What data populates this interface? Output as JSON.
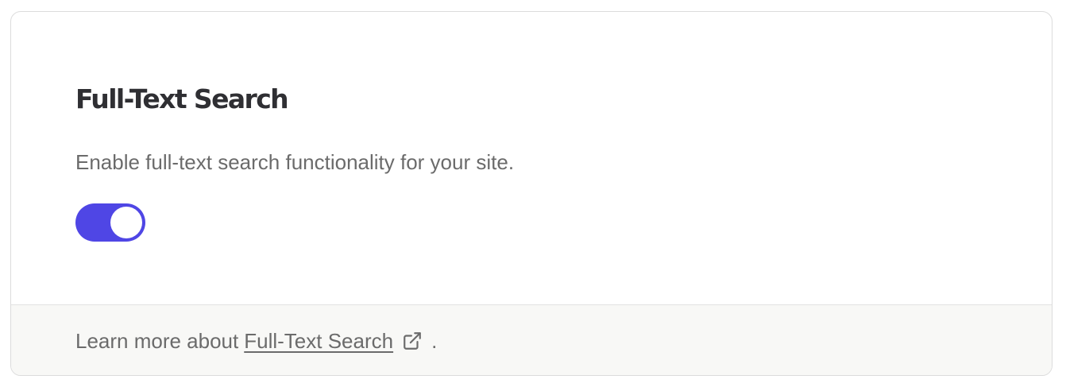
{
  "card": {
    "title": "Full-Text Search",
    "description": "Enable full-text search functionality for your site.",
    "toggle": {
      "state": "on",
      "accent_color": "#4f46e5"
    }
  },
  "footer": {
    "prefix": "Learn more about",
    "link_label": "Full-Text Search",
    "link_icon": "external-link-icon",
    "suffix": "."
  }
}
